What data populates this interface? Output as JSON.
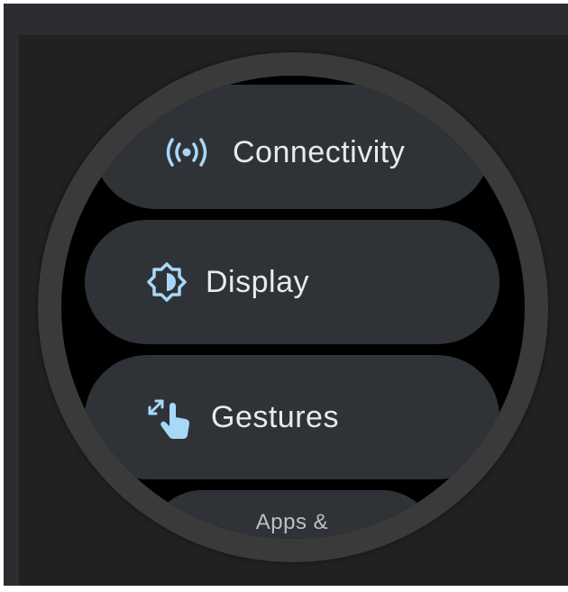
{
  "menu": {
    "items": [
      {
        "label": "Connectivity",
        "icon": "connectivity-icon"
      },
      {
        "label": "Display",
        "icon": "display-brightness-icon"
      },
      {
        "label": "Gestures",
        "icon": "gestures-icon"
      },
      {
        "label": "Apps &",
        "icon": ""
      }
    ]
  },
  "colors": {
    "accent": "#a8d8f8",
    "chip": "#2f3337",
    "text": "#e8eaed"
  }
}
